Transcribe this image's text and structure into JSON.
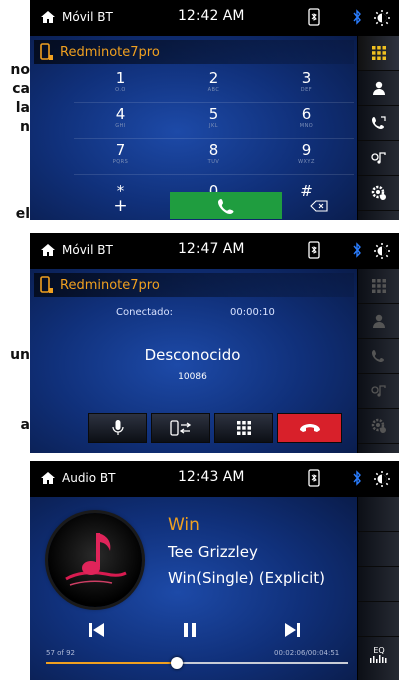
{
  "edge_text": {
    "line1": "no",
    "line2": "ca",
    "line3": "la",
    "line4": "n",
    "line5": "el",
    "line6": "un",
    "line7": "a"
  },
  "screen1": {
    "app_title": "Móvil BT",
    "time": "12:42 AM",
    "device_name": "Redminote7pro",
    "keys": [
      {
        "digit": "1",
        "letters": "O.O"
      },
      {
        "digit": "2",
        "letters": "ABC"
      },
      {
        "digit": "3",
        "letters": "DEF"
      },
      {
        "digit": "4",
        "letters": "GHI"
      },
      {
        "digit": "5",
        "letters": "JKL"
      },
      {
        "digit": "6",
        "letters": "MNO"
      },
      {
        "digit": "7",
        "letters": "PQRS"
      },
      {
        "digit": "8",
        "letters": "TUV"
      },
      {
        "digit": "9",
        "letters": "WXYZ"
      },
      {
        "digit": "*",
        "letters": ""
      },
      {
        "digit": "0",
        "letters": ""
      },
      {
        "digit": "#",
        "letters": ""
      }
    ],
    "plus_label": "+"
  },
  "screen2": {
    "app_title": "Móvil BT",
    "time": "12:47 AM",
    "device_name": "Redminote7pro",
    "status_label": "Conectado:",
    "duration": "00:00:10",
    "caller_name": "Desconocido",
    "caller_number": "10086"
  },
  "screen3": {
    "app_title": "Audio BT",
    "time": "12:43 AM",
    "song_title": "Win",
    "artist": "Tee Grizzley",
    "album": "Win(Single) (Explicit)",
    "track_position": "57 of 92",
    "elapsed_total": "00:02:06/00:04:51",
    "progress_fraction": 0.433,
    "eq_label": "EQ"
  },
  "colors": {
    "accent": "#f0a020",
    "call_green": "#1f9d3f",
    "hangup_red": "#d8202a",
    "sidebar_active": "#f0c020"
  }
}
